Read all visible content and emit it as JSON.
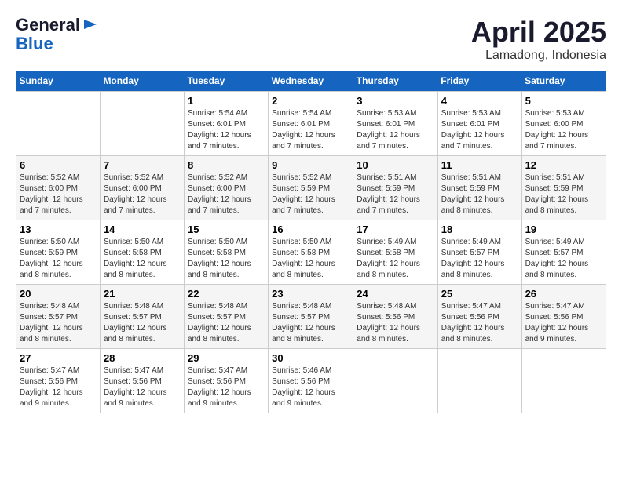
{
  "logo": {
    "general": "General",
    "blue": "Blue"
  },
  "title": "April 2025",
  "location": "Lamadong, Indonesia",
  "days_header": [
    "Sunday",
    "Monday",
    "Tuesday",
    "Wednesday",
    "Thursday",
    "Friday",
    "Saturday"
  ],
  "weeks": [
    [
      {
        "day": "",
        "sunrise": "",
        "sunset": "",
        "daylight": ""
      },
      {
        "day": "",
        "sunrise": "",
        "sunset": "",
        "daylight": ""
      },
      {
        "day": "1",
        "sunrise": "Sunrise: 5:54 AM",
        "sunset": "Sunset: 6:01 PM",
        "daylight": "Daylight: 12 hours and 7 minutes."
      },
      {
        "day": "2",
        "sunrise": "Sunrise: 5:54 AM",
        "sunset": "Sunset: 6:01 PM",
        "daylight": "Daylight: 12 hours and 7 minutes."
      },
      {
        "day": "3",
        "sunrise": "Sunrise: 5:53 AM",
        "sunset": "Sunset: 6:01 PM",
        "daylight": "Daylight: 12 hours and 7 minutes."
      },
      {
        "day": "4",
        "sunrise": "Sunrise: 5:53 AM",
        "sunset": "Sunset: 6:01 PM",
        "daylight": "Daylight: 12 hours and 7 minutes."
      },
      {
        "day": "5",
        "sunrise": "Sunrise: 5:53 AM",
        "sunset": "Sunset: 6:00 PM",
        "daylight": "Daylight: 12 hours and 7 minutes."
      }
    ],
    [
      {
        "day": "6",
        "sunrise": "Sunrise: 5:52 AM",
        "sunset": "Sunset: 6:00 PM",
        "daylight": "Daylight: 12 hours and 7 minutes."
      },
      {
        "day": "7",
        "sunrise": "Sunrise: 5:52 AM",
        "sunset": "Sunset: 6:00 PM",
        "daylight": "Daylight: 12 hours and 7 minutes."
      },
      {
        "day": "8",
        "sunrise": "Sunrise: 5:52 AM",
        "sunset": "Sunset: 6:00 PM",
        "daylight": "Daylight: 12 hours and 7 minutes."
      },
      {
        "day": "9",
        "sunrise": "Sunrise: 5:52 AM",
        "sunset": "Sunset: 5:59 PM",
        "daylight": "Daylight: 12 hours and 7 minutes."
      },
      {
        "day": "10",
        "sunrise": "Sunrise: 5:51 AM",
        "sunset": "Sunset: 5:59 PM",
        "daylight": "Daylight: 12 hours and 7 minutes."
      },
      {
        "day": "11",
        "sunrise": "Sunrise: 5:51 AM",
        "sunset": "Sunset: 5:59 PM",
        "daylight": "Daylight: 12 hours and 8 minutes."
      },
      {
        "day": "12",
        "sunrise": "Sunrise: 5:51 AM",
        "sunset": "Sunset: 5:59 PM",
        "daylight": "Daylight: 12 hours and 8 minutes."
      }
    ],
    [
      {
        "day": "13",
        "sunrise": "Sunrise: 5:50 AM",
        "sunset": "Sunset: 5:59 PM",
        "daylight": "Daylight: 12 hours and 8 minutes."
      },
      {
        "day": "14",
        "sunrise": "Sunrise: 5:50 AM",
        "sunset": "Sunset: 5:58 PM",
        "daylight": "Daylight: 12 hours and 8 minutes."
      },
      {
        "day": "15",
        "sunrise": "Sunrise: 5:50 AM",
        "sunset": "Sunset: 5:58 PM",
        "daylight": "Daylight: 12 hours and 8 minutes."
      },
      {
        "day": "16",
        "sunrise": "Sunrise: 5:50 AM",
        "sunset": "Sunset: 5:58 PM",
        "daylight": "Daylight: 12 hours and 8 minutes."
      },
      {
        "day": "17",
        "sunrise": "Sunrise: 5:49 AM",
        "sunset": "Sunset: 5:58 PM",
        "daylight": "Daylight: 12 hours and 8 minutes."
      },
      {
        "day": "18",
        "sunrise": "Sunrise: 5:49 AM",
        "sunset": "Sunset: 5:57 PM",
        "daylight": "Daylight: 12 hours and 8 minutes."
      },
      {
        "day": "19",
        "sunrise": "Sunrise: 5:49 AM",
        "sunset": "Sunset: 5:57 PM",
        "daylight": "Daylight: 12 hours and 8 minutes."
      }
    ],
    [
      {
        "day": "20",
        "sunrise": "Sunrise: 5:48 AM",
        "sunset": "Sunset: 5:57 PM",
        "daylight": "Daylight: 12 hours and 8 minutes."
      },
      {
        "day": "21",
        "sunrise": "Sunrise: 5:48 AM",
        "sunset": "Sunset: 5:57 PM",
        "daylight": "Daylight: 12 hours and 8 minutes."
      },
      {
        "day": "22",
        "sunrise": "Sunrise: 5:48 AM",
        "sunset": "Sunset: 5:57 PM",
        "daylight": "Daylight: 12 hours and 8 minutes."
      },
      {
        "day": "23",
        "sunrise": "Sunrise: 5:48 AM",
        "sunset": "Sunset: 5:57 PM",
        "daylight": "Daylight: 12 hours and 8 minutes."
      },
      {
        "day": "24",
        "sunrise": "Sunrise: 5:48 AM",
        "sunset": "Sunset: 5:56 PM",
        "daylight": "Daylight: 12 hours and 8 minutes."
      },
      {
        "day": "25",
        "sunrise": "Sunrise: 5:47 AM",
        "sunset": "Sunset: 5:56 PM",
        "daylight": "Daylight: 12 hours and 8 minutes."
      },
      {
        "day": "26",
        "sunrise": "Sunrise: 5:47 AM",
        "sunset": "Sunset: 5:56 PM",
        "daylight": "Daylight: 12 hours and 9 minutes."
      }
    ],
    [
      {
        "day": "27",
        "sunrise": "Sunrise: 5:47 AM",
        "sunset": "Sunset: 5:56 PM",
        "daylight": "Daylight: 12 hours and 9 minutes."
      },
      {
        "day": "28",
        "sunrise": "Sunrise: 5:47 AM",
        "sunset": "Sunset: 5:56 PM",
        "daylight": "Daylight: 12 hours and 9 minutes."
      },
      {
        "day": "29",
        "sunrise": "Sunrise: 5:47 AM",
        "sunset": "Sunset: 5:56 PM",
        "daylight": "Daylight: 12 hours and 9 minutes."
      },
      {
        "day": "30",
        "sunrise": "Sunrise: 5:46 AM",
        "sunset": "Sunset: 5:56 PM",
        "daylight": "Daylight: 12 hours and 9 minutes."
      },
      {
        "day": "",
        "sunrise": "",
        "sunset": "",
        "daylight": ""
      },
      {
        "day": "",
        "sunrise": "",
        "sunset": "",
        "daylight": ""
      },
      {
        "day": "",
        "sunrise": "",
        "sunset": "",
        "daylight": ""
      }
    ]
  ]
}
